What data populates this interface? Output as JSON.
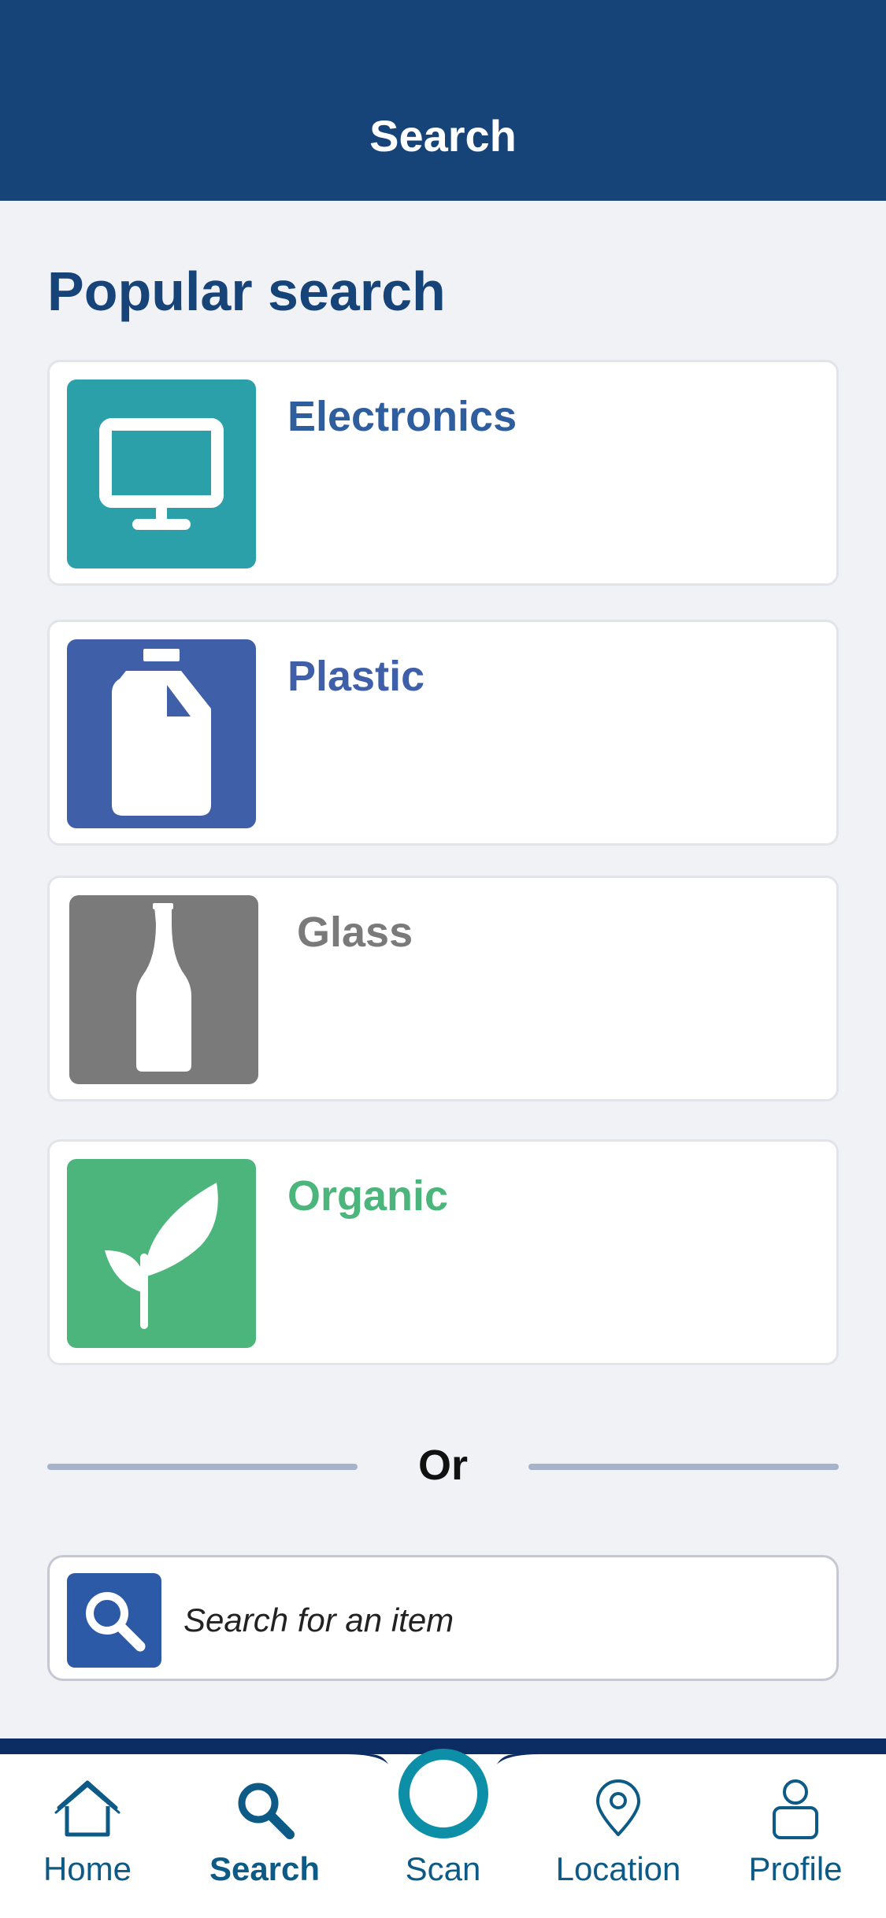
{
  "header": {
    "title": "Search"
  },
  "popular": {
    "title": "Popular search",
    "items": [
      {
        "label": "Electronics",
        "color": "#2ca0a8",
        "text_color": "#2f5e9e",
        "icon": "monitor-icon"
      },
      {
        "label": "Plastic",
        "color": "#3f5fa8",
        "text_color": "#3f5fa8",
        "icon": "plastic-jug-icon"
      },
      {
        "label": "Glass",
        "color": "#7a7a7a",
        "text_color": "#7a7a7a",
        "icon": "glass-bottle-icon"
      },
      {
        "label": "Organic",
        "color": "#4cb57b",
        "text_color": "#4cb57b",
        "icon": "leaf-sprout-icon"
      }
    ]
  },
  "divider": {
    "text": "Or"
  },
  "search": {
    "placeholder": "Search for an item",
    "icon": "search-icon"
  },
  "nav": {
    "items": [
      {
        "label": "Home",
        "icon": "home-icon",
        "active": false
      },
      {
        "label": "Search",
        "icon": "search-icon",
        "active": true
      },
      {
        "label": "Scan",
        "icon": "scan-icon",
        "active": false
      },
      {
        "label": "Location",
        "icon": "location-pin-icon",
        "active": false
      },
      {
        "label": "Profile",
        "icon": "profile-icon",
        "active": false
      }
    ]
  }
}
